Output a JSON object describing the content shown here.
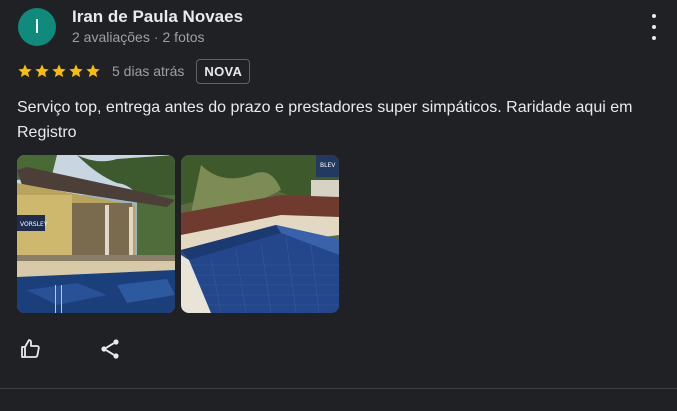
{
  "author": {
    "initial": "I",
    "name": "Iran de Paula Novaes",
    "reviews_count": "2 avaliações",
    "photos_count": "2 fotos",
    "avatar_color": "#0f8a7b"
  },
  "review": {
    "rating": 5,
    "date": "5 dias atrás",
    "badge": "NOVA",
    "text": "Serviço top, entrega antes do prazo e prestadores super simpáticos. Raridade aqui em Registro",
    "star_color": "#fbbc04"
  },
  "photos": [
    {
      "watermark": "VORSLEY"
    },
    {
      "watermark": "BLEV"
    }
  ],
  "icons": {
    "menu": "more-vert-icon",
    "like": "thumb-up-icon",
    "share": "share-icon",
    "star": "star-icon"
  }
}
